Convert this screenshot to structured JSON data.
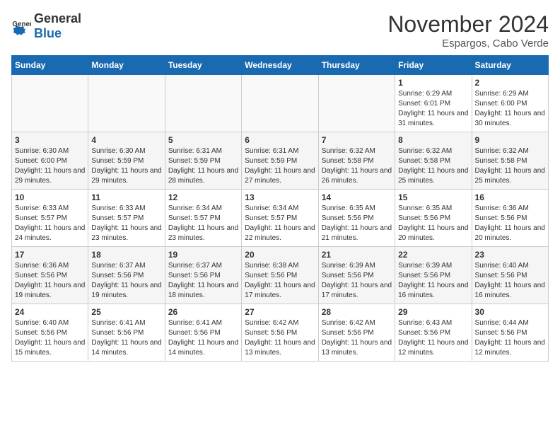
{
  "logo": {
    "general": "General",
    "blue": "Blue"
  },
  "title": "November 2024",
  "subtitle": "Espargos, Cabo Verde",
  "days_of_week": [
    "Sunday",
    "Monday",
    "Tuesday",
    "Wednesday",
    "Thursday",
    "Friday",
    "Saturday"
  ],
  "weeks": [
    [
      {
        "day": "",
        "info": ""
      },
      {
        "day": "",
        "info": ""
      },
      {
        "day": "",
        "info": ""
      },
      {
        "day": "",
        "info": ""
      },
      {
        "day": "",
        "info": ""
      },
      {
        "day": "1",
        "info": "Sunrise: 6:29 AM\nSunset: 6:01 PM\nDaylight: 11 hours and 31 minutes."
      },
      {
        "day": "2",
        "info": "Sunrise: 6:29 AM\nSunset: 6:00 PM\nDaylight: 11 hours and 30 minutes."
      }
    ],
    [
      {
        "day": "3",
        "info": "Sunrise: 6:30 AM\nSunset: 6:00 PM\nDaylight: 11 hours and 29 minutes."
      },
      {
        "day": "4",
        "info": "Sunrise: 6:30 AM\nSunset: 5:59 PM\nDaylight: 11 hours and 29 minutes."
      },
      {
        "day": "5",
        "info": "Sunrise: 6:31 AM\nSunset: 5:59 PM\nDaylight: 11 hours and 28 minutes."
      },
      {
        "day": "6",
        "info": "Sunrise: 6:31 AM\nSunset: 5:59 PM\nDaylight: 11 hours and 27 minutes."
      },
      {
        "day": "7",
        "info": "Sunrise: 6:32 AM\nSunset: 5:58 PM\nDaylight: 11 hours and 26 minutes."
      },
      {
        "day": "8",
        "info": "Sunrise: 6:32 AM\nSunset: 5:58 PM\nDaylight: 11 hours and 25 minutes."
      },
      {
        "day": "9",
        "info": "Sunrise: 6:32 AM\nSunset: 5:58 PM\nDaylight: 11 hours and 25 minutes."
      }
    ],
    [
      {
        "day": "10",
        "info": "Sunrise: 6:33 AM\nSunset: 5:57 PM\nDaylight: 11 hours and 24 minutes."
      },
      {
        "day": "11",
        "info": "Sunrise: 6:33 AM\nSunset: 5:57 PM\nDaylight: 11 hours and 23 minutes."
      },
      {
        "day": "12",
        "info": "Sunrise: 6:34 AM\nSunset: 5:57 PM\nDaylight: 11 hours and 23 minutes."
      },
      {
        "day": "13",
        "info": "Sunrise: 6:34 AM\nSunset: 5:57 PM\nDaylight: 11 hours and 22 minutes."
      },
      {
        "day": "14",
        "info": "Sunrise: 6:35 AM\nSunset: 5:56 PM\nDaylight: 11 hours and 21 minutes."
      },
      {
        "day": "15",
        "info": "Sunrise: 6:35 AM\nSunset: 5:56 PM\nDaylight: 11 hours and 20 minutes."
      },
      {
        "day": "16",
        "info": "Sunrise: 6:36 AM\nSunset: 5:56 PM\nDaylight: 11 hours and 20 minutes."
      }
    ],
    [
      {
        "day": "17",
        "info": "Sunrise: 6:36 AM\nSunset: 5:56 PM\nDaylight: 11 hours and 19 minutes."
      },
      {
        "day": "18",
        "info": "Sunrise: 6:37 AM\nSunset: 5:56 PM\nDaylight: 11 hours and 19 minutes."
      },
      {
        "day": "19",
        "info": "Sunrise: 6:37 AM\nSunset: 5:56 PM\nDaylight: 11 hours and 18 minutes."
      },
      {
        "day": "20",
        "info": "Sunrise: 6:38 AM\nSunset: 5:56 PM\nDaylight: 11 hours and 17 minutes."
      },
      {
        "day": "21",
        "info": "Sunrise: 6:39 AM\nSunset: 5:56 PM\nDaylight: 11 hours and 17 minutes."
      },
      {
        "day": "22",
        "info": "Sunrise: 6:39 AM\nSunset: 5:56 PM\nDaylight: 11 hours and 16 minutes."
      },
      {
        "day": "23",
        "info": "Sunrise: 6:40 AM\nSunset: 5:56 PM\nDaylight: 11 hours and 16 minutes."
      }
    ],
    [
      {
        "day": "24",
        "info": "Sunrise: 6:40 AM\nSunset: 5:56 PM\nDaylight: 11 hours and 15 minutes."
      },
      {
        "day": "25",
        "info": "Sunrise: 6:41 AM\nSunset: 5:56 PM\nDaylight: 11 hours and 14 minutes."
      },
      {
        "day": "26",
        "info": "Sunrise: 6:41 AM\nSunset: 5:56 PM\nDaylight: 11 hours and 14 minutes."
      },
      {
        "day": "27",
        "info": "Sunrise: 6:42 AM\nSunset: 5:56 PM\nDaylight: 11 hours and 13 minutes."
      },
      {
        "day": "28",
        "info": "Sunrise: 6:42 AM\nSunset: 5:56 PM\nDaylight: 11 hours and 13 minutes."
      },
      {
        "day": "29",
        "info": "Sunrise: 6:43 AM\nSunset: 5:56 PM\nDaylight: 11 hours and 12 minutes."
      },
      {
        "day": "30",
        "info": "Sunrise: 6:44 AM\nSunset: 5:56 PM\nDaylight: 11 hours and 12 minutes."
      }
    ]
  ]
}
